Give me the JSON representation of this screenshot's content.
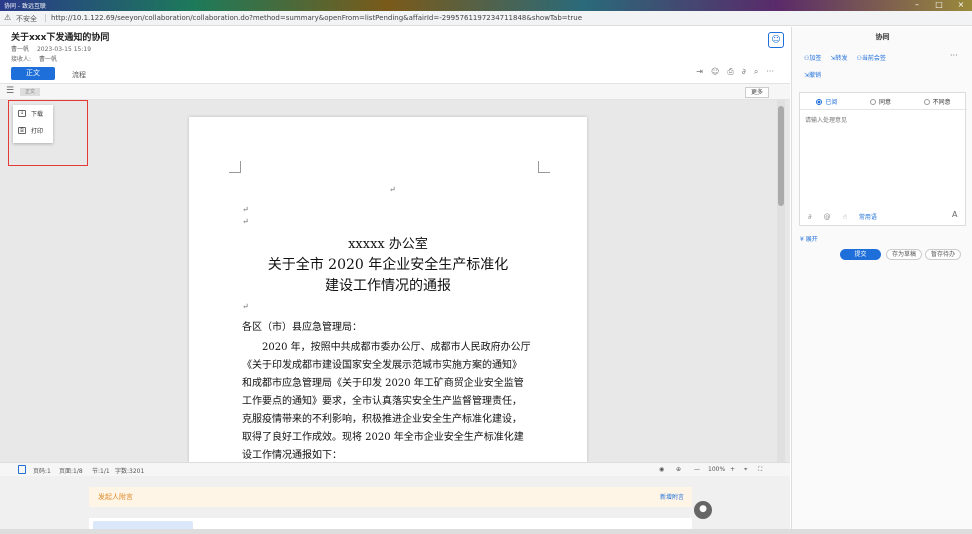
{
  "browser": {
    "tab_title": "协同 - 致远互联",
    "insecure_label": "不安全",
    "url": "http://10.1.122.69/seeyon/collaboration/collaboration.do?method=summary&openFrom=listPending&affairId=-2995761197234711848&showTab=true"
  },
  "header": {
    "title": "关于xxx下发通知的协同",
    "sender": "曹一帆",
    "time": "2023-03-15 15:19",
    "receiver_label": "接收人:",
    "receiver": "曹一帆",
    "tabs": [
      {
        "label": "正文"
      },
      {
        "label": "流程"
      }
    ]
  },
  "toolbar": {
    "mini_tag": "正文",
    "more_label": "更多"
  },
  "popup_menu": {
    "items": [
      {
        "label": "下载"
      },
      {
        "label": "打印"
      }
    ]
  },
  "document": {
    "org": "xxxxx 办公室",
    "title_line1": "关于全市 2020 年企业安全生产标准化",
    "title_line2": "建设工作情况的通报",
    "salutation": "各区（市）县应急管理局：",
    "body_lines": [
      "　　2020 年，按照中共成都市委办公厅、成都市人民政府办公厅",
      "《关于印发成都市建设国家安全发展示范城市实施方案的通知》",
      "和成都市应急管理局《关于印发 2020 年工矿商贸企业安全监管",
      "工作要点的通知》要求，全市认真落实安全生产监督管理责任，",
      "克服疫情带来的不利影响，积极推进企业安全生产标准化建设，",
      "取得了良好工作成效。现将 2020 年全市企业安全生产标准化建",
      "设工作情况通报如下："
    ]
  },
  "statusbar": {
    "page": "页码:1",
    "page_of": "页面:1/8",
    "section": "节:1/1",
    "word_count": "字数:3201",
    "zoom": "100%"
  },
  "attachments": {
    "title": "发起人附言",
    "add_label": "新增附言"
  },
  "panel": {
    "title": "协同",
    "actions": [
      {
        "label": "加签"
      },
      {
        "label": "转发"
      },
      {
        "label": "当前会签"
      }
    ],
    "withdraw_label": "撤销",
    "more_label": "···",
    "radios": [
      {
        "label": "已阅"
      },
      {
        "label": "同意"
      },
      {
        "label": "不同意"
      }
    ],
    "opinion_placeholder": "请输入处理意见",
    "common_phrases": "常用语",
    "expand_label": "展开",
    "submit_label": "提交",
    "save_draft_label": "存为草稿",
    "pause_label": "暂存待办"
  },
  "colors": {
    "accent": "#1e6fd9",
    "attach_title": "#e08a2c",
    "highlight_border": "#e53935"
  }
}
